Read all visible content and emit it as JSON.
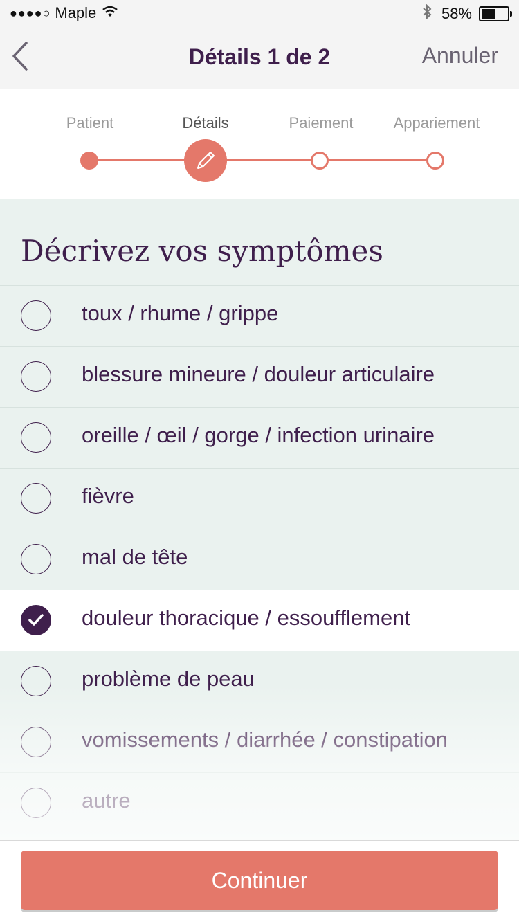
{
  "status_bar": {
    "carrier": "Maple",
    "signal_dots": "●●●●○",
    "battery": "58%",
    "battery_level": 0.58
  },
  "nav": {
    "title": "Détails 1 de 2",
    "cancel_label": "Annuler"
  },
  "stepper": {
    "accent_color": "#e4786a",
    "steps": [
      {
        "label": "Patient",
        "state": "done"
      },
      {
        "label": "Détails",
        "state": "active"
      },
      {
        "label": "Paiement",
        "state": "todo"
      },
      {
        "label": "Appariement",
        "state": "todo"
      }
    ]
  },
  "symptoms": {
    "title": "Décrivez vos symptômes",
    "options": [
      {
        "label": "toux / rhume / grippe",
        "checked": false
      },
      {
        "label": "blessure mineure / douleur articulaire",
        "checked": false
      },
      {
        "label": "oreille / œil / gorge / infection urinaire",
        "checked": false
      },
      {
        "label": "fièvre",
        "checked": false
      },
      {
        "label": "mal de tête",
        "checked": false
      },
      {
        "label": "douleur thoracique / essoufflement",
        "checked": true
      },
      {
        "label": "problème de peau",
        "checked": false
      },
      {
        "label": "vomissements / diarrhée / constipation",
        "checked": false
      },
      {
        "label": "autre",
        "checked": false
      }
    ]
  },
  "footer": {
    "continue_label": "Continuer"
  },
  "colors": {
    "primary_text": "#3f1f4c",
    "accent": "#e4786a",
    "list_background": "#eaf2ef"
  }
}
